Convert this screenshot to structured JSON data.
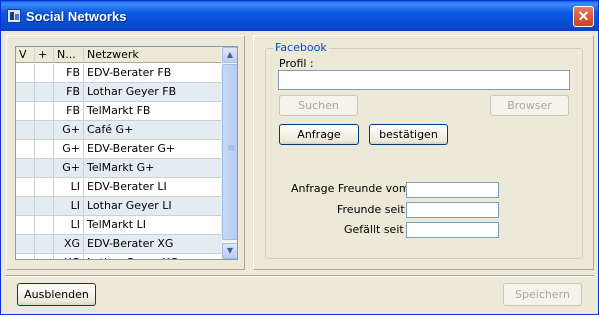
{
  "window": {
    "title": "Social Networks",
    "close_glyph": "✕"
  },
  "grid": {
    "columns": [
      "V",
      "+",
      "N...",
      "Netzwerk"
    ],
    "rows": [
      {
        "tag": "FB",
        "name": "EDV-Berater FB"
      },
      {
        "tag": "FB",
        "name": "Lothar Geyer FB"
      },
      {
        "tag": "FB",
        "name": "TelMarkt FB"
      },
      {
        "tag": "G+",
        "name": "Café G+"
      },
      {
        "tag": "G+",
        "name": "EDV-Berater G+"
      },
      {
        "tag": "G+",
        "name": "TelMarkt G+"
      },
      {
        "tag": "LI",
        "name": "EDV-Berater LI"
      },
      {
        "tag": "LI",
        "name": "Lothar Geyer LI"
      },
      {
        "tag": "LI",
        "name": "TelMarkt LI"
      },
      {
        "tag": "XG",
        "name": "EDV-Berater XG"
      },
      {
        "tag": "XG",
        "name": "Lothar Geyer XG"
      }
    ]
  },
  "facebook": {
    "group_label": "Facebook",
    "profile_label": "Profil :",
    "profile_value": "",
    "search_button": "Suchen",
    "browser_button": "Browser",
    "request_button": "Anfrage",
    "confirm_button": "bestätigen",
    "friend_request_label": "Anfrage Freunde vom :",
    "friends_since_label": "Freunde seit :",
    "liked_since_label": "Gefällt seit :"
  },
  "footer": {
    "hide_button": "Ausblenden",
    "save_button": "Speichern"
  }
}
